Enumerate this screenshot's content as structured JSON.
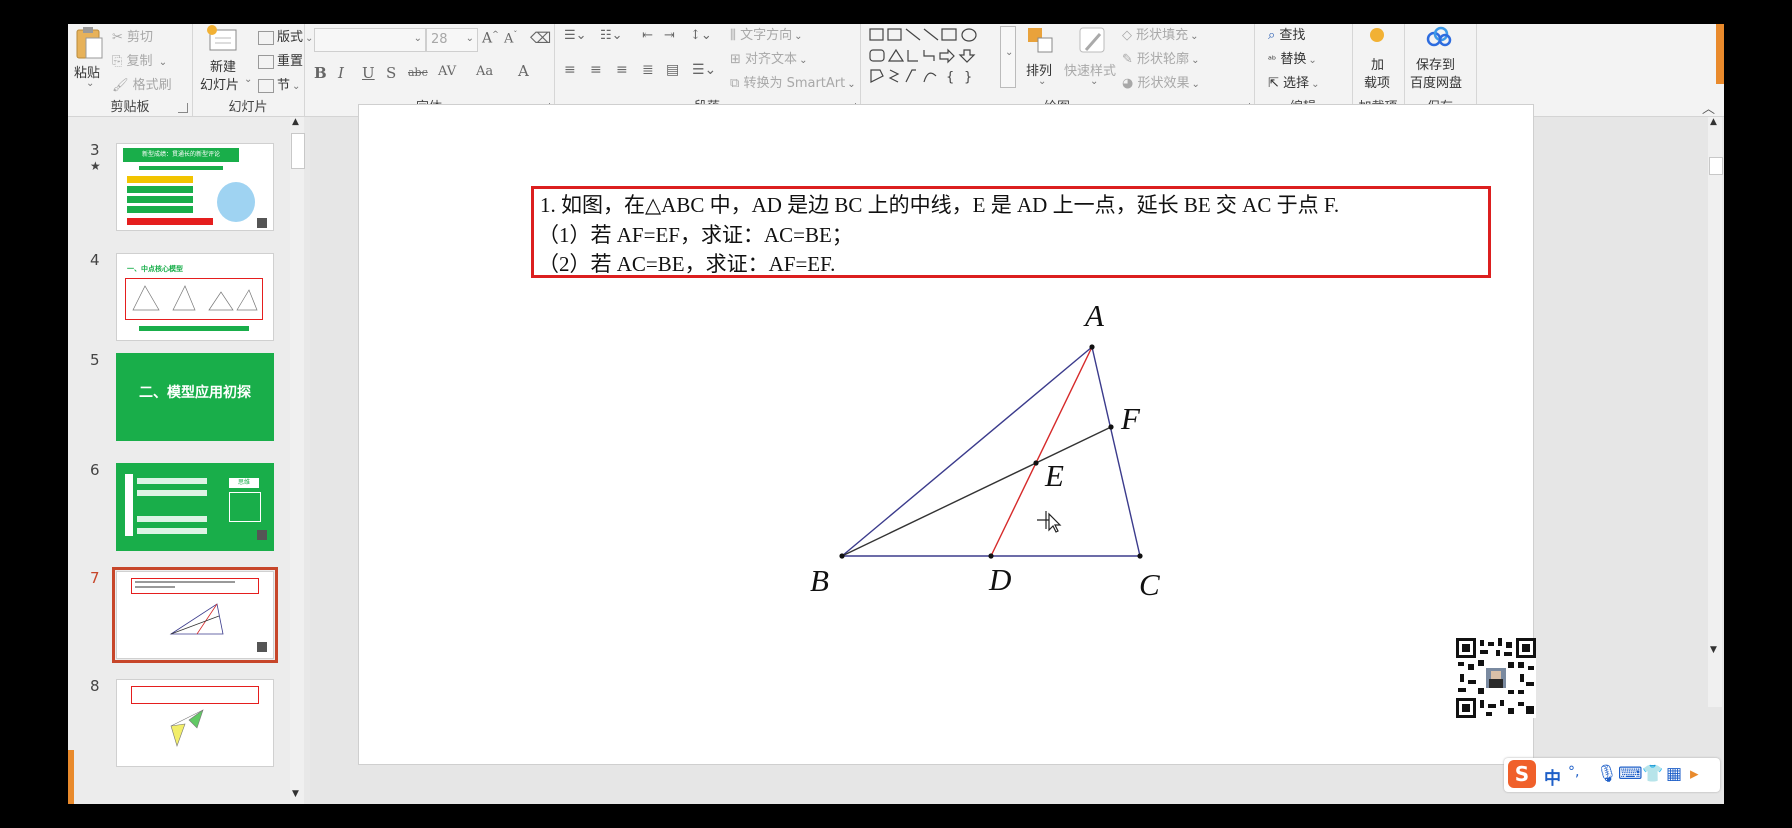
{
  "ribbon": {
    "clipboard": {
      "paste": "粘贴",
      "cut": "剪切",
      "copy": "复制",
      "format_painter": "格式刷",
      "label": "剪贴板"
    },
    "slides": {
      "new_slide_line1": "新建",
      "new_slide_line2": "幻灯片",
      "layout": "版式",
      "reset": "重置",
      "section": "节",
      "label": "幻灯片"
    },
    "font": {
      "size": "28",
      "label": "字体",
      "buttons": [
        "B",
        "I",
        "U",
        "S",
        "abc",
        "AV",
        "Aa",
        "A"
      ]
    },
    "paragraph": {
      "text_direction": "文字方向",
      "align_text": "对齐文本",
      "convert_smartart": "转换为 SmartArt",
      "label": "段落"
    },
    "drawing": {
      "arrange": "排列",
      "quick_styles": "快速样式",
      "shape_fill": "形状填充",
      "shape_outline": "形状轮廓",
      "shape_effects": "形状效果",
      "label": "绘图"
    },
    "editing": {
      "find": "查找",
      "replace": "替换",
      "select": "选择",
      "label": "编辑"
    },
    "addins": {
      "line1": "加",
      "line2": "载项",
      "label": "加载项"
    },
    "save": {
      "line1": "保存到",
      "line2": "百度网盘",
      "label": "保存"
    }
  },
  "slides": [
    {
      "num": "3",
      "star": "★",
      "title": "新型成绩：贯通长的新型评论"
    },
    {
      "num": "4",
      "title": "一、中点核心模型"
    },
    {
      "num": "5",
      "title": "二、模型应用初探"
    },
    {
      "num": "6",
      "title": "思维"
    },
    {
      "num": "7",
      "title": ""
    },
    {
      "num": "8",
      "title": ""
    }
  ],
  "current_slide": {
    "question_lines": [
      "1. 如图，在△ABC 中，AD 是边 BC 上的中线，E 是 AD 上一点，延长 BE 交 AC 于点 F.",
      "（1）若 AF=EF，求证：AC=BE；",
      "（2）若 AC=BE，求证：AF=EF."
    ],
    "points": {
      "A": "A",
      "B": "B",
      "C": "C",
      "D": "D",
      "E": "E",
      "F": "F"
    }
  },
  "tray": {
    "lang": "中",
    "punct": "°,"
  },
  "colors": {
    "accent": "#c7462a",
    "question_border": "#dc1f1f",
    "triangle": "#3b3b8c",
    "median": "#d62a2a",
    "segment": "#333333",
    "slide_green": "#19ae4a"
  }
}
